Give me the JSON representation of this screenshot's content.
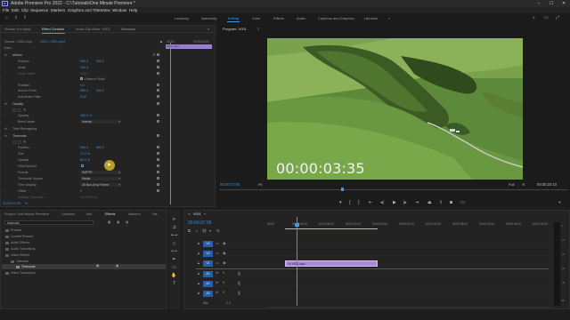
{
  "app": {
    "title": "Adobe Premiere Pro 2022 - C:\\Tutorials\\One Minute Premiere *",
    "logo_text": "Pr"
  },
  "menu": [
    "File",
    "Edit",
    "Clip",
    "Sequence",
    "Markers",
    "Graphics and Titles",
    "View",
    "Window",
    "Help"
  ],
  "workspaces": {
    "items": [
      "Learning",
      "Assembly",
      "Editing",
      "Color",
      "Effects",
      "Audio",
      "Captions and Graphics",
      "Libraries"
    ],
    "active": "Editing",
    "more": "»"
  },
  "effect_controls": {
    "tabs": [
      "Source: (no clips)",
      "Effect Controls",
      "Audio Clip Mixer: V001",
      "Metadata"
    ],
    "menu_icon": "≡",
    "source_label": "Source • V001.mp4",
    "sequence_label": "V001 • V001.mp4",
    "time_start": "00:00",
    "time_end": "00:00:16:00",
    "clip_name": "V001.mp4",
    "section_video": "Video",
    "motion": {
      "label": "Motion",
      "position_label": "Position",
      "position_x": "960.0",
      "position_y": "540.0",
      "scale_label": "Scale",
      "scale_value": "100.0",
      "scale_width_label": "Scale Width",
      "scale_width_value": "100.0",
      "uniform_scale_label": "Uniform Scale",
      "rotation_label": "Rotation",
      "rotation_value": "0.0",
      "anchor_label": "Anchor Point",
      "anchor_x": "960.0",
      "anchor_y": "540.0",
      "antiflicker_label": "Anti-flicker Filter",
      "antiflicker_value": "0.00"
    },
    "opacity": {
      "label": "Opacity",
      "opacity_label": "Opacity",
      "opacity_value": "100.0 %",
      "blend_label": "Blend Mode",
      "blend_value": "Normal"
    },
    "time_remap_label": "Time Remapping",
    "timecode_effect": {
      "label": "Timecode",
      "position_label": "Position",
      "position_x": "960.0",
      "position_y": "882.0",
      "size_label": "Size",
      "size_value": "22.0 %",
      "opacity_label": "Opacity",
      "opacity_value": "60.0 %",
      "field_symbol_label": "Field Symbol",
      "format_label": "Format",
      "format_value": "SMPTE",
      "source_label": "Timecode Source",
      "source_value": "Media",
      "display_label": "Time Display",
      "display_value": "30 Non-Drop Frame",
      "offset_label": "Offset",
      "offset_value": "0",
      "label_text_label": "Starting Timecode",
      "label_text_value": "00:00:00:00"
    },
    "current_time": "00:00:07:05"
  },
  "program": {
    "title": "Program: V001",
    "menu_icon": "≡",
    "overlay_timecode": "00:00:03:35",
    "current_time": "00:00:07:05",
    "fit": "Fit",
    "quality": "Full",
    "duration": "00:00:20:10"
  },
  "project": {
    "tabs": [
      "Project: One Minute Premiere",
      "Libraries",
      "Info",
      "Effects",
      "Markers",
      "His"
    ],
    "search_value": "timecode",
    "tree": [
      {
        "label": "Presets",
        "indent": 0,
        "folder": true
      },
      {
        "label": "Lumetri Presets",
        "indent": 0,
        "folder": true
      },
      {
        "label": "Audio Effects",
        "indent": 0,
        "folder": true
      },
      {
        "label": "Audio Transitions",
        "indent": 0,
        "folder": true
      },
      {
        "label": "Video Effects",
        "indent": 0,
        "folder": true
      },
      {
        "label": "Obsolete",
        "indent": 1,
        "folder": true
      },
      {
        "label": "Timecode",
        "indent": 2,
        "folder": false
      },
      {
        "label": "Video Transitions",
        "indent": 0,
        "folder": true
      }
    ]
  },
  "timeline": {
    "tab": "V001",
    "current_time": "00:00:07:05",
    "ruler": [
      "00:00",
      "00:00:04:00",
      "00:00:08:00",
      "00:00:12:00",
      "00:00:16:00",
      "00:00:20:00",
      "00:00:24:00",
      "00:00:28:00",
      "00:00:32:00",
      "00:00:36:00",
      "00:00:40:00"
    ],
    "video_tracks": [
      "V3",
      "V2",
      "V1"
    ],
    "audio_tracks": [
      "A1",
      "A2",
      "A3"
    ],
    "mix_label": "Mix",
    "mix_value": "0.0",
    "clip_label": "fx  V001.mp4",
    "meter_scale": [
      "0",
      "-12",
      "-24",
      "-36",
      "-48",
      "dB"
    ]
  }
}
